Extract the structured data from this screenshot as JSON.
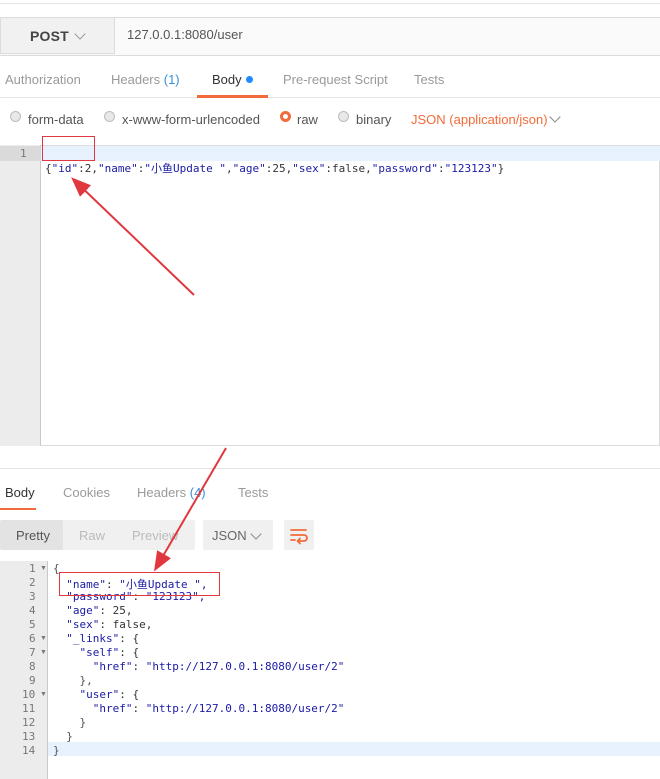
{
  "request": {
    "method": "POST",
    "url": "127.0.0.1:8080/user"
  },
  "tabs": [
    {
      "label": "Authorization"
    },
    {
      "label": "Headers ",
      "count": "(1)"
    },
    {
      "label": "Body"
    },
    {
      "label": "Pre-request Script"
    },
    {
      "label": "Tests"
    }
  ],
  "body_types": [
    "form-data",
    "x-www-form-urlencoded",
    "raw",
    "binary"
  ],
  "selected_body_type": "raw",
  "content_type": "JSON (application/json)",
  "request_editor": {
    "line_number": "1",
    "parts": [
      "{",
      "\"id\"",
      ":",
      "2",
      ",",
      "\"name\"",
      ":",
      "\"小鱼Update \"",
      ",",
      "\"age\"",
      ":",
      "25",
      ",",
      "\"sex\"",
      ":",
      "false",
      ",",
      "\"password\"",
      ":",
      "\"123123\"",
      "}"
    ]
  },
  "response": {
    "tabs": [
      {
        "label": "Body"
      },
      {
        "label": "Cookies"
      },
      {
        "label": "Headers ",
        "count": "(4)"
      },
      {
        "label": "Tests"
      }
    ],
    "view_modes": [
      "Pretty",
      "Raw",
      "Preview"
    ],
    "format": "JSON",
    "line_numbers": [
      "1",
      "2",
      "3",
      "4",
      "5",
      "6",
      "7",
      "8",
      "9",
      "10",
      "11",
      "12",
      "13",
      "14"
    ],
    "lines": [
      "{",
      "  \"name\": \"小鱼Update \",",
      "  \"password\": \"123123\",",
      "  \"age\": 25,",
      "  \"sex\": false,",
      "  \"_links\": {",
      "    \"self\": {",
      "      \"href\": \"http://127.0.0.1:8080/user/2\"",
      "    },",
      "    \"user\": {",
      "      \"href\": \"http://127.0.0.1:8080/user/2\"",
      "    }",
      "  }",
      "}"
    ]
  },
  "colors": {
    "accent": "#f26b3a",
    "annotation": "#e0383e",
    "code_key": "#1a1aa6"
  }
}
